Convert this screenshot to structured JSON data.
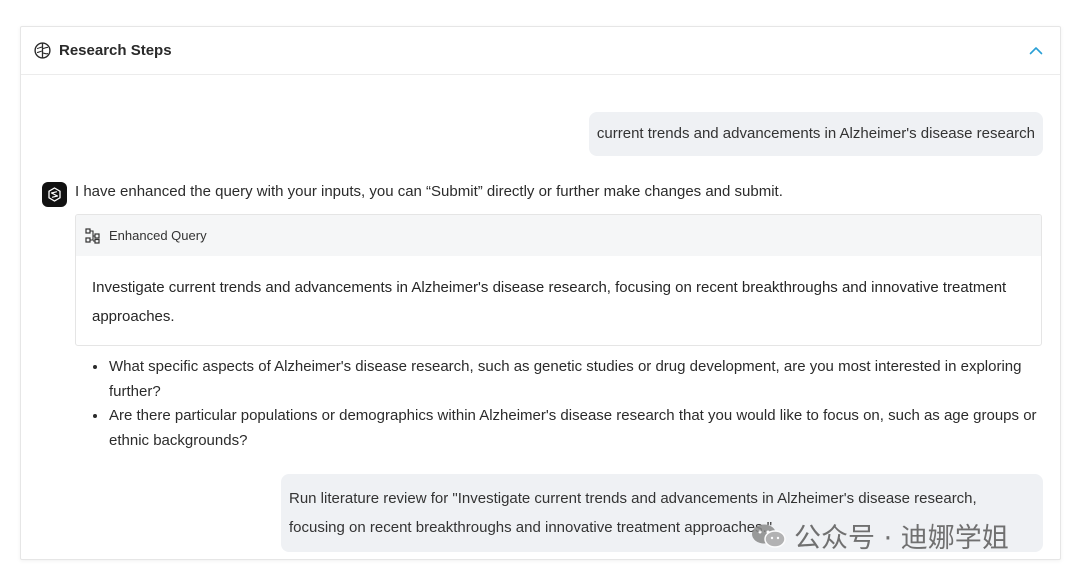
{
  "panel": {
    "title": "Research Steps",
    "icons": {
      "title_icon": "brain-icon",
      "collapse_icon": "chevron-up-icon"
    }
  },
  "conversation": {
    "user_query": "current trends and advancements in Alzheimer's disease research",
    "bot_message": "I have enhanced the query with your inputs, you can “Submit” directly or further make changes and submit.",
    "enhanced_query": {
      "label": "Enhanced Query",
      "icon": "nodes-icon",
      "text": "Investigate current trends and advancements in Alzheimer's disease research, focusing on recent breakthroughs and innovative treatment approaches."
    },
    "follow_up_questions": [
      "What specific aspects of Alzheimer's disease research, such as genetic studies or drug development, are you most interested in exploring further?",
      "Are there particular populations or demographics within Alzheimer's disease research that you would like to focus on, such as age groups or ethnic backgrounds?"
    ],
    "user_command": "Run literature review for \"Investigate current trends and advancements in Alzheimer's disease research, focusing on recent breakthroughs and innovative treatment approaches.\""
  },
  "watermark": {
    "text": "公众号 · 迪娜学姐"
  },
  "colors": {
    "accent": "#2a9fd6",
    "bubble_bg": "#eff1f4",
    "avatar_bg": "#111111"
  }
}
